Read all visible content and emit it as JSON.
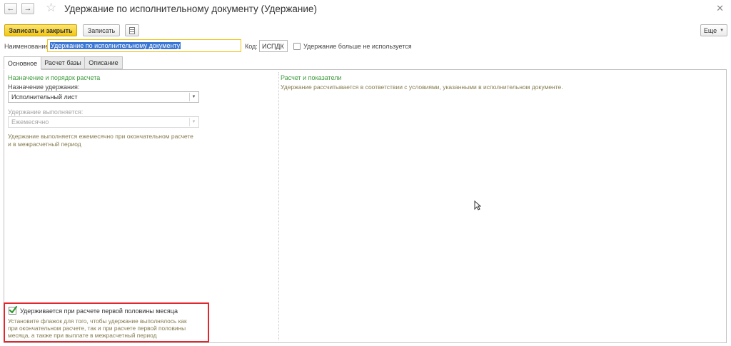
{
  "window": {
    "title": "Удержание по исполнительному документу (Удержание)",
    "back_icon": "←",
    "forward_icon": "→",
    "star_icon": "☆",
    "close_icon": "✕"
  },
  "toolbar": {
    "save_close_label": "Записать и закрыть",
    "save_label": "Записать",
    "more_label": "Еще"
  },
  "header": {
    "name_label": "Наименование:",
    "name_value": "Удержание по исполнительному документу",
    "code_label": "Код:",
    "code_value": "ИСПДК",
    "unused_label": "Удержание больше не используется"
  },
  "tabs": [
    {
      "label": "Основное"
    },
    {
      "label": "Расчет базы"
    },
    {
      "label": "Описание"
    }
  ],
  "left": {
    "section_title": "Назначение и порядок расчета",
    "purpose_label": "Назначение удержания:",
    "purpose_value": "Исполнительный лист",
    "executes_label": "Удержание выполняется:",
    "executes_value": "Ежемесячно",
    "executes_hint_1": "Удержание выполняется ежемесячно при окончательном расчете",
    "executes_hint_2": "и в межрасчетный период",
    "first_half_label": "Удерживается при расчете первой половины месяца",
    "first_half_hint_1": "Установите флажок для того, чтобы удержание выполнялось как",
    "first_half_hint_2": "при окончательном расчете, так и при расчете первой половины",
    "first_half_hint_3": "месяца, а также при выплате в межрасчетный период"
  },
  "right": {
    "section_title": "Расчет и показатели",
    "info_text": "Удержание рассчитывается в соответствии с условиями, указанными в исполнительном документе."
  },
  "colors": {
    "accent_yellow": "#f4c712",
    "section_green": "#3e9a3e",
    "hint_olive": "#837a4e",
    "highlight_red": "#e3262d",
    "selection_blue": "#3a77d4"
  }
}
